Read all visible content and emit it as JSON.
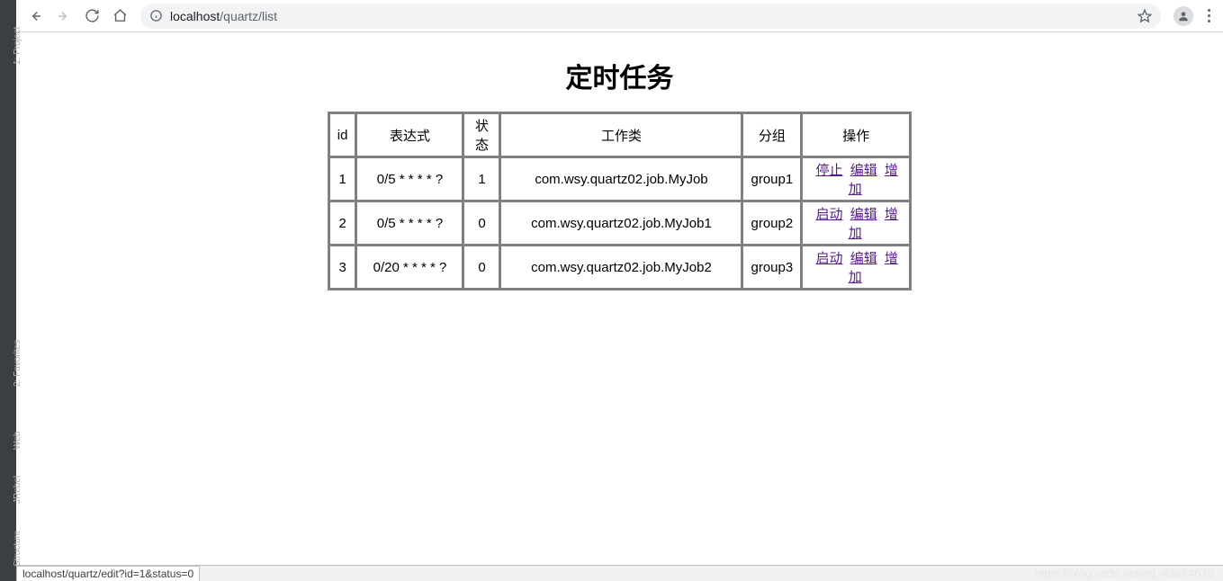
{
  "ide": {
    "sidebar_labels": [
      "1: Project",
      "2: Favorites",
      "Web",
      "JRebel",
      "Structure"
    ]
  },
  "browser": {
    "url_host": "localhost",
    "url_path": "/quartz/list"
  },
  "page": {
    "title": "定时任务"
  },
  "table": {
    "headers": {
      "id": "id",
      "expression": "表达式",
      "status": "状态",
      "job_class": "工作类",
      "group": "分组",
      "operations": "操作"
    },
    "rows": [
      {
        "id": "1",
        "expression": "0/5 * * * * ?",
        "status": "1",
        "job_class": "com.wsy.quartz02.job.MyJob",
        "group": "group1",
        "actions": {
          "toggle": "停止",
          "edit": "编辑",
          "add": "增加"
        }
      },
      {
        "id": "2",
        "expression": "0/5 * * * * ?",
        "status": "0",
        "job_class": "com.wsy.quartz02.job.MyJob1",
        "group": "group2",
        "actions": {
          "toggle": "启动",
          "edit": "编辑",
          "add": "增加"
        }
      },
      {
        "id": "3",
        "expression": "0/20 * * * * ?",
        "status": "0",
        "job_class": "com.wsy.quartz02.job.MyJob2",
        "group": "group3",
        "actions": {
          "toggle": "启动",
          "edit": "编辑",
          "add": "增加"
        }
      }
    ]
  },
  "status_bar": {
    "text": "localhost/quartz/edit?id=1&status=0",
    "watermark": "https://blog.csdn.net/qq_43624670"
  }
}
